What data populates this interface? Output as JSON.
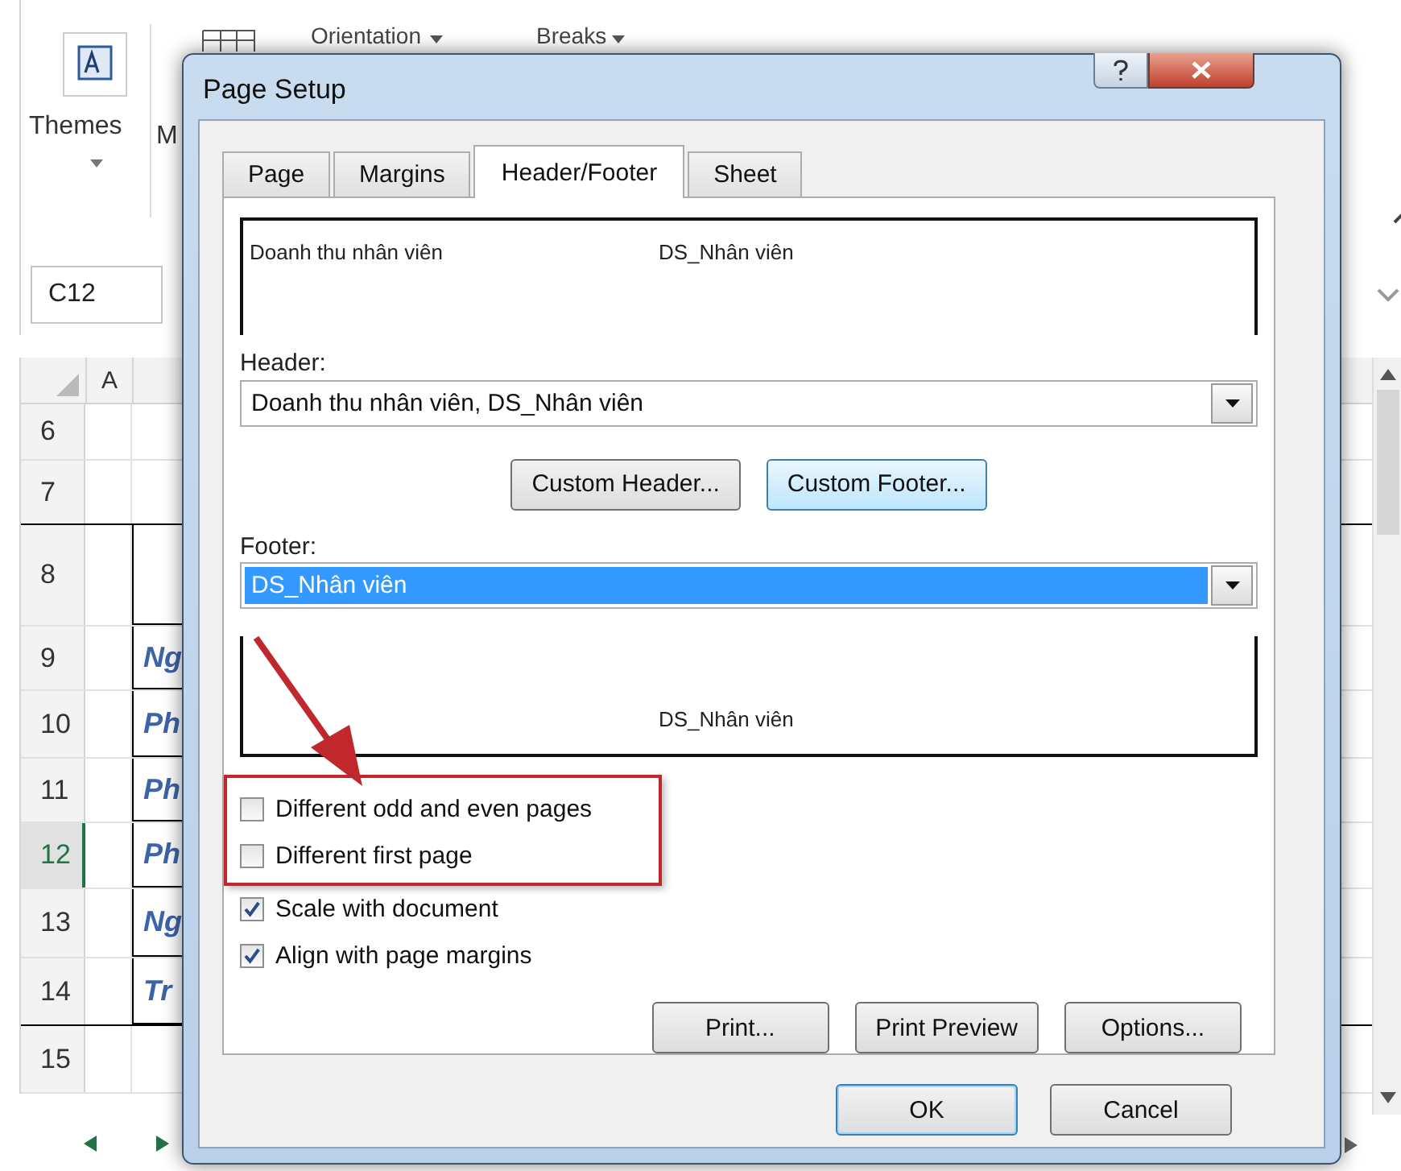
{
  "excel": {
    "ribbon": {
      "themes": "Themes",
      "cut_label": "M",
      "orientation": "Orientation",
      "breaks": "Breaks"
    },
    "name_box": "C12",
    "column": "A",
    "rows": [
      {
        "number": "6",
        "cell": "",
        "selected": false
      },
      {
        "number": "7",
        "cell": "",
        "selected": false
      },
      {
        "number": "8",
        "cell": "",
        "selected": false
      },
      {
        "number": "9",
        "cell": "Ng",
        "selected": false
      },
      {
        "number": "10",
        "cell": "Ph",
        "selected": false
      },
      {
        "number": "11",
        "cell": "Ph",
        "selected": false
      },
      {
        "number": "12",
        "cell": "Ph",
        "selected": true
      },
      {
        "number": "13",
        "cell": "Ng",
        "selected": false
      },
      {
        "number": "14",
        "cell": "Tr",
        "selected": false
      },
      {
        "number": "15",
        "cell": "",
        "selected": false
      }
    ]
  },
  "dialog": {
    "title": "Page Setup",
    "tabs": [
      {
        "label": "Page",
        "selected": false
      },
      {
        "label": "Margins",
        "selected": false
      },
      {
        "label": "Header/Footer",
        "selected": true
      },
      {
        "label": "Sheet",
        "selected": false
      }
    ],
    "header_preview": {
      "left": "Doanh thu nhân viên",
      "center": "DS_Nhân viên"
    },
    "header_label": {
      "text": "Header:"
    },
    "header_value": "Doanh thu nhân viên, DS_Nhân viên",
    "custom_buttons": [
      {
        "label": "Custom Header...",
        "focused": false
      },
      {
        "label": "Custom Footer...",
        "focused": true
      }
    ],
    "footer_label": {
      "text": "Footer:"
    },
    "footer_value": {
      "text": "DS_Nhân viên",
      "selected": true
    },
    "footer_preview": {
      "center": "DS_Nhân viên"
    },
    "options": [
      {
        "label": "Different odd and even pages",
        "checked": false,
        "highlighted": true
      },
      {
        "label": "Different first page",
        "checked": false,
        "highlighted": true
      },
      {
        "label": "Scale with document",
        "checked": true,
        "highlighted": false
      },
      {
        "label": "Align with page margins",
        "checked": true,
        "highlighted": false
      }
    ],
    "action_buttons": [
      {
        "label": "Print..."
      },
      {
        "label": "Print Preview"
      },
      {
        "label": "Options..."
      }
    ],
    "dialog_buttons": [
      {
        "label": "OK",
        "default": true
      },
      {
        "label": "Cancel",
        "default": false
      }
    ]
  }
}
